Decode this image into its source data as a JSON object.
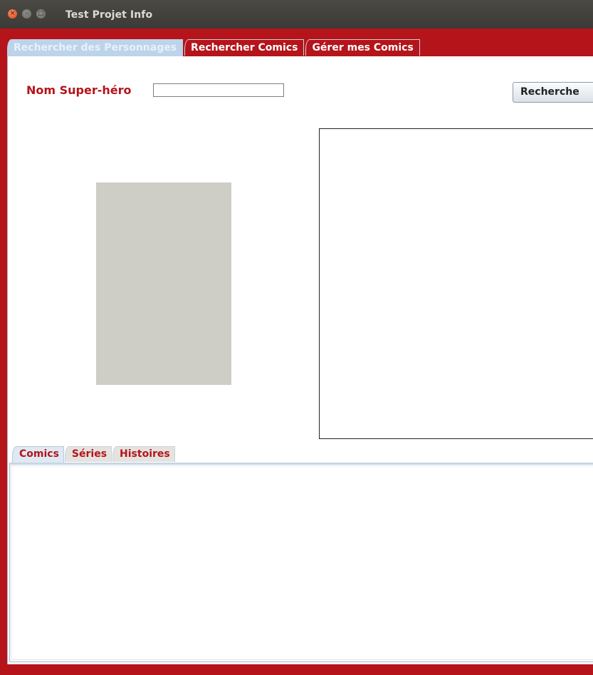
{
  "window": {
    "title": "Test Projet Info",
    "controls": {
      "close_icon": "×",
      "min_icon": "–",
      "max_icon": "□"
    }
  },
  "main_tabs": [
    {
      "label": "Rechercher des Personnages",
      "selected": true
    },
    {
      "label": "Rechercher Comics",
      "selected": false
    },
    {
      "label": "Gérer mes Comics",
      "selected": false
    }
  ],
  "search": {
    "label": "Nom Super-héro",
    "value": "",
    "placeholder": "",
    "button_label": "Recherche"
  },
  "sub_tabs": [
    {
      "label": "Comics",
      "selected": true
    },
    {
      "label": "Séries",
      "selected": false
    },
    {
      "label": "Histoires",
      "selected": false
    }
  ],
  "colors": {
    "accent_red": "#b4141a",
    "selected_tab_blue": "#bcd4ea",
    "image_placeholder_gray": "#cecdc6"
  }
}
